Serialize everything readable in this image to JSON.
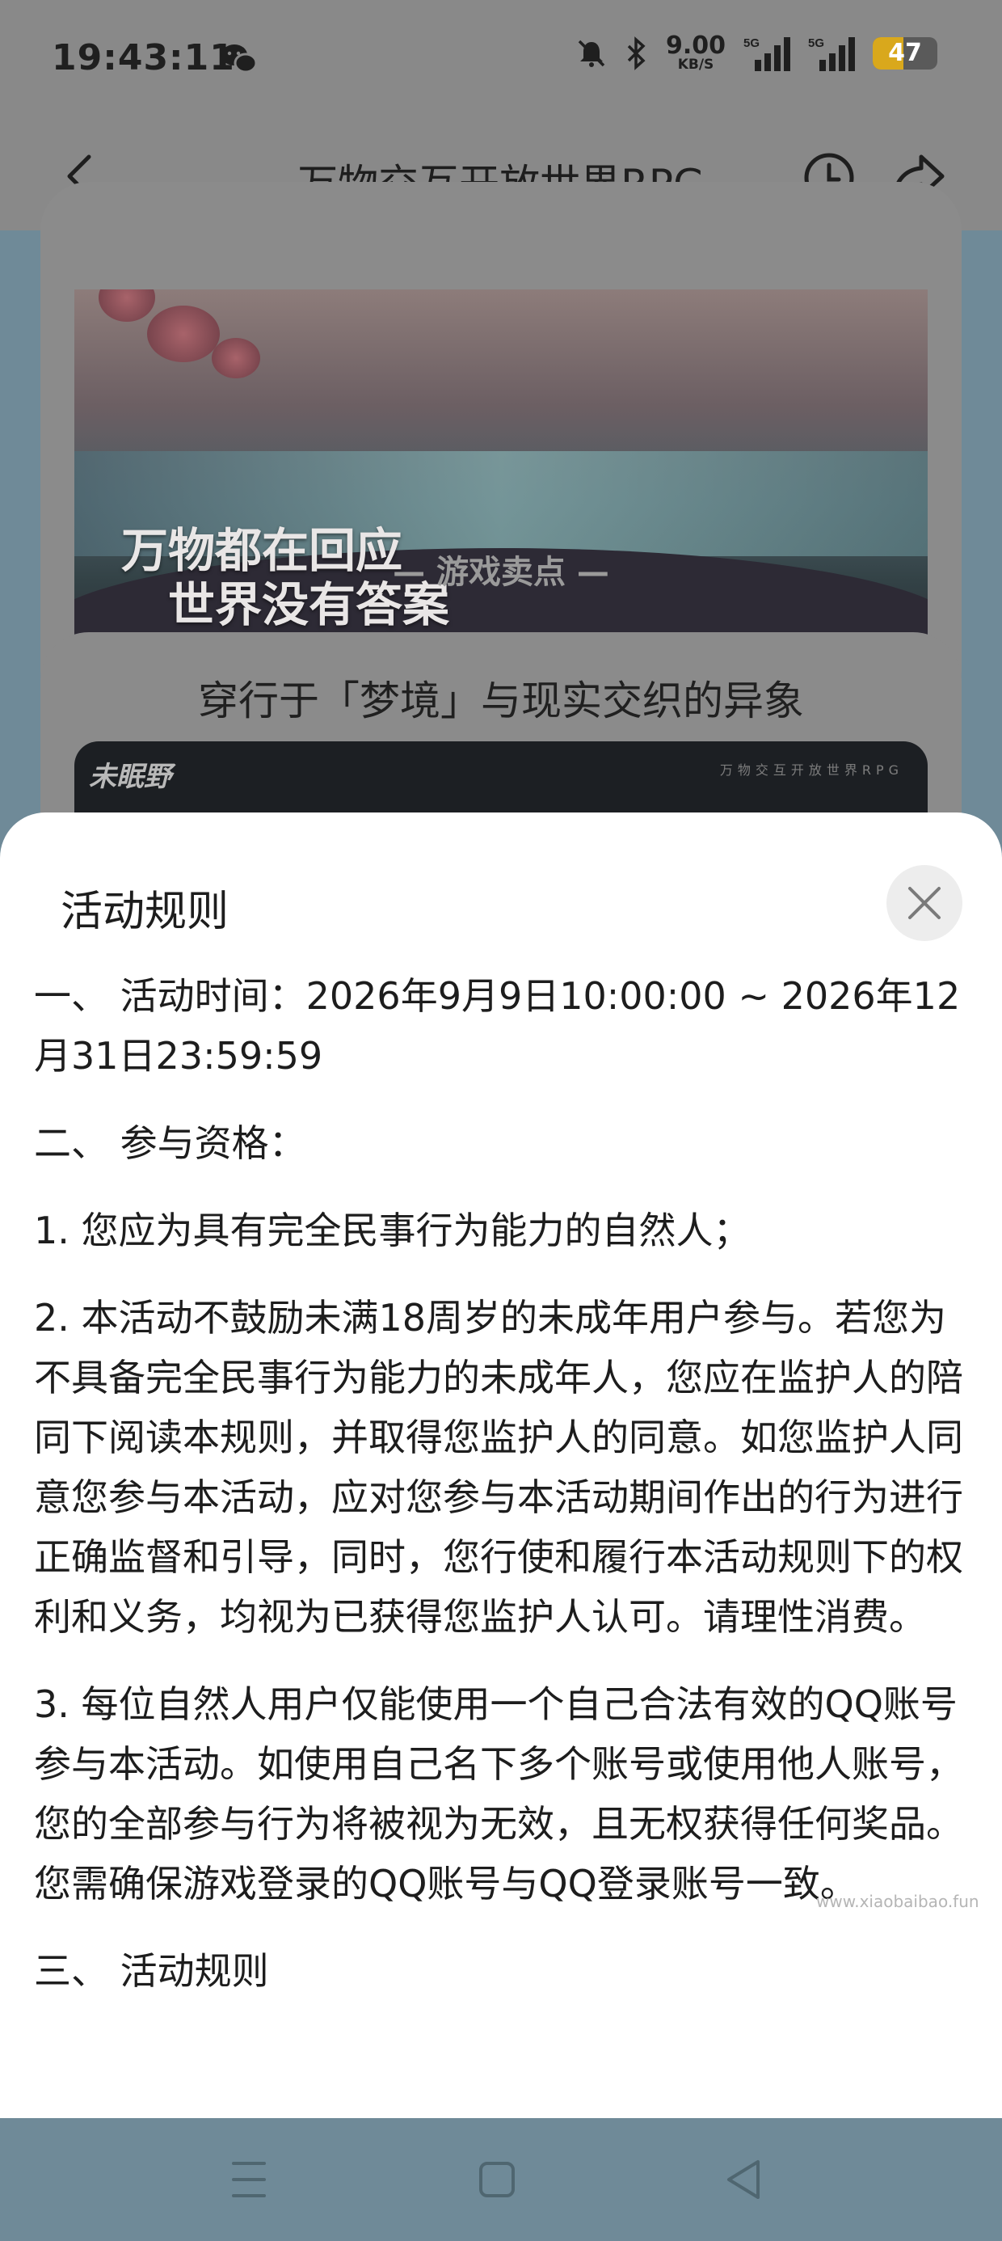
{
  "status_bar": {
    "time": "19:43:11",
    "net_speed_value": "9.00",
    "net_speed_unit": "KB/S",
    "signal_label_1": "5G",
    "signal_label_2": "5G",
    "battery_level": "47",
    "battery_fraction": 0.47,
    "icons": [
      "wechat-icon",
      "mute-icon",
      "bluetooth-icon",
      "signal-icon",
      "battery-icon"
    ]
  },
  "nav": {
    "title": "万物交互开放世界RPG",
    "icons": [
      "back-icon",
      "history-icon",
      "share-icon"
    ]
  },
  "background": {
    "banner_line1": "万物都在回应",
    "banner_line2": "世界没有答案",
    "section_label": "— 游戏卖点 —",
    "card_title": "穿行于「梦境」与现实交织的异象",
    "video_logo": "未眠野",
    "video_tag": "万物交互开放世界RPG"
  },
  "modal": {
    "title": "活动规则",
    "close_icon": "close-icon",
    "rules": [
      "一、 活动时间：2026年9月9日10:00:00 ~ 2026年12月31日23:59:59",
      "二、 参与资格：",
      "1. 您应为具有完全民事行为能力的自然人；",
      "2. 本活动不鼓励未满18周岁的未成年用户参与。若您为不具备完全民事行为能力的未成年人，您应在监护人的陪同下阅读本规则，并取得您监护人的同意。如您监护人同意您参与本活动，应对您参与本活动期间作出的行为进行正确监督和引导，同时，您行使和履行本活动规则下的权利和义务，均视为已获得您监护人认可。请理性消费。",
      "3. 每位自然人用户仅能使用一个自己合法有效的QQ账号参与本活动。如使用自己名下多个账号或使用他人账号，您的全部参与行为将被视为无效，且无权获得任何奖品。您需确保游戏登录的QQ账号与QQ登录账号一致。",
      "三、 活动规则"
    ]
  },
  "watermark": "www.xiaobaibao.fun",
  "system_nav": {
    "icons": [
      "menu-icon",
      "home-icon",
      "back-triangle-icon"
    ]
  }
}
